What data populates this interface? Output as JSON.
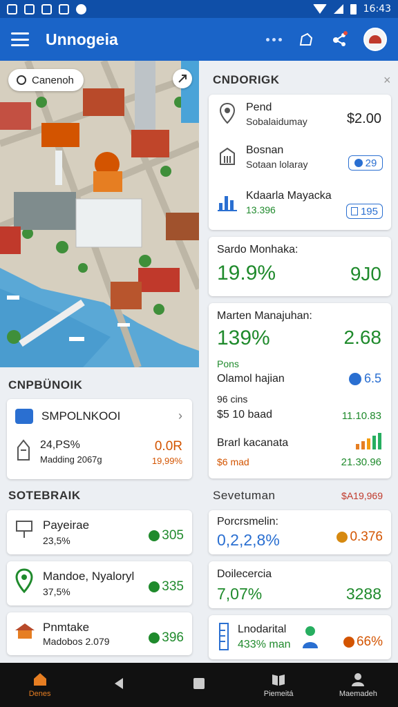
{
  "status_bar": {
    "time": "16:43"
  },
  "app_bar": {
    "title": "Unnogeia"
  },
  "map": {
    "chip_label": "Canenoh"
  },
  "panel": {
    "heading": "CNDORIGK",
    "close": "×",
    "rows": [
      {
        "title": "Pend",
        "subtitle": "Sobalaidumay",
        "value": "$2.00"
      },
      {
        "title": "Bosnan",
        "subtitle": "Sotaan lolaray",
        "pill": "29"
      },
      {
        "title": "Kdaarla Mayacka",
        "subtitle": "13.396",
        "pill": "195"
      }
    ]
  },
  "stat1": {
    "title": "Sardo Monhaka:",
    "value": "19.9%",
    "right": "9J0"
  },
  "stat2": {
    "title": "Marten Manajuhan:",
    "value": "139%",
    "right": "2.68",
    "label": "Pons",
    "sub_title": "Olamol hajian",
    "sub_value": "6.5",
    "line3": "96 cins",
    "line4": "$5 10 baad",
    "line4_value": "11.10.83",
    "line5": "Brarl kacanata",
    "line6": "$6 mad",
    "line6_value": "21.30.96"
  },
  "left_section": {
    "heading": "CNPBÜNOIK",
    "card_title": "SMPOLNKOOI",
    "row_title": "24,PS%",
    "row_subtitle": "Madding 2067g",
    "row_value": "0.0R",
    "row_value2": "19,99%"
  },
  "list_section": {
    "heading": "SOTEBRAIK",
    "items": [
      {
        "title": "Payeirae",
        "subtitle": "23,5%",
        "badge": "305"
      },
      {
        "title": "Mandoe, Nyaloryl",
        "subtitle": "37,5%",
        "badge": "335"
      },
      {
        "title": "Pnmtake",
        "subtitle": "Madobos 2.079",
        "badge": "396"
      }
    ]
  },
  "right_section": {
    "heading": "Sevetuman",
    "heading_value": "$A19,969",
    "cards": [
      {
        "title": "Porcrsmelin:",
        "value": "0,2,2,8%",
        "badge": "0.376"
      },
      {
        "title": "Doilecercia",
        "value": "7,07%",
        "right": "3288"
      },
      {
        "title": "Lnodarital",
        "subtitle": "433% man",
        "badge": "66%"
      }
    ]
  },
  "nav": [
    {
      "label": "Denes"
    },
    {
      "label": ""
    },
    {
      "label": ""
    },
    {
      "label": "Piemeitá"
    },
    {
      "label": "Maemadeh"
    }
  ],
  "colors": {
    "primary": "#1a64c8",
    "status": "#0f4fa8",
    "green": "#1f8a2c",
    "orange": "#d35400"
  }
}
